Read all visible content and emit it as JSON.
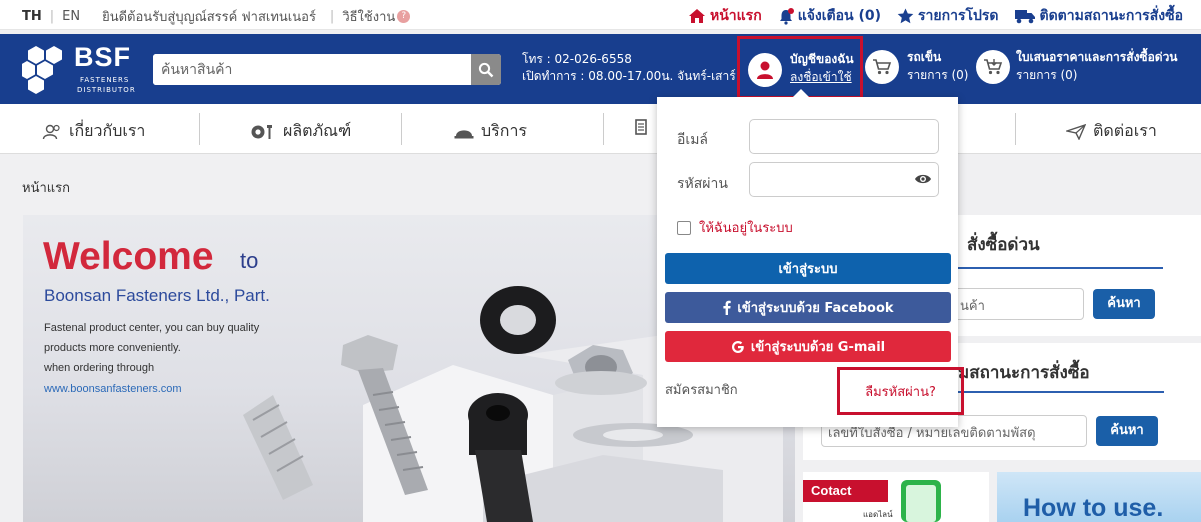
{
  "topbar": {
    "lang_th": "TH",
    "lang_en": "EN",
    "welcome": "ยินดีต้อนรับสู่บุญณ์สรรค์ ฟาสเทนเนอร์",
    "how_to": "วิธีใช้งาน",
    "help_icon": "?",
    "home": "หน้าแรก",
    "notifications": "แจ้งเตือน (0)",
    "favorites": "รายการโปรด",
    "track": "ติดตามสถานะการสั่งซื้อ"
  },
  "header": {
    "brand": "BSF",
    "brand_sub1": "FASTENERS",
    "brand_sub2": "DISTRIBUTOR",
    "search_placeholder": "ค้นหาสินค้า",
    "phone": "โทร : 02-026-6558",
    "hours": "เปิดทำการ : 08.00-17.00น. จันทร์-เสาร์",
    "account_title": "บัญชีของฉัน",
    "account_sub": "ลงชื่อเข้าใช้",
    "cart_title": "รถเข็น",
    "cart_sub": "รายการ (0)",
    "quote_title": "ใบเสนอราคาและการสั่งซื้อด่วน",
    "quote_sub": "รายการ (0)"
  },
  "nav": {
    "about": "เกี่ยวกับเรา",
    "products": "ผลิตภัณฑ์",
    "services": "บริการ",
    "contact": "ติดต่อเรา"
  },
  "breadcrumb": "หน้าแรก",
  "banner": {
    "welcome": "Welcome",
    "to": "to",
    "company": "Boonsan Fasteners Ltd., Part.",
    "desc_line1": "Fastenal product center, you can buy quality",
    "desc_line2": "products more conveniently.",
    "desc_line3": "when ordering through",
    "url": "www.boonsanfasteners.com"
  },
  "quick_order": {
    "title": "สั่งซื้อด่วน",
    "input_text": "นค้า",
    "button": "ค้นหา"
  },
  "track_order": {
    "title": "มสถานะการสั่งซื้อ",
    "placeholder": "เลขที่ใบสั่งซื้อ / หมายเลขติดตามพัสดุ",
    "button": "ค้นหา"
  },
  "promo": {
    "contact_tag": "Cotact",
    "online_text": "แอดไลน์",
    "how_to_use": "How to use."
  },
  "login": {
    "email_label": "อีเมล์",
    "password_label": "รหัสผ่าน",
    "remember": "ให้ฉันอยู่ในระบบ",
    "login_button": "เข้าสู่ระบบ",
    "facebook_button": "เข้าสู่ระบบด้วย Facebook",
    "gmail_button": "เข้าสู่ระบบด้วย G-mail",
    "register": "สมัครสมาชิก",
    "forgot": "ลืมรหัสผ่าน?"
  },
  "colors": {
    "header_blue": "#183e8e",
    "brand_red": "#c8102e",
    "login_blue": "#0e62ad",
    "facebook_blue": "#3d5a9b",
    "gmail_red": "#e0283c"
  }
}
